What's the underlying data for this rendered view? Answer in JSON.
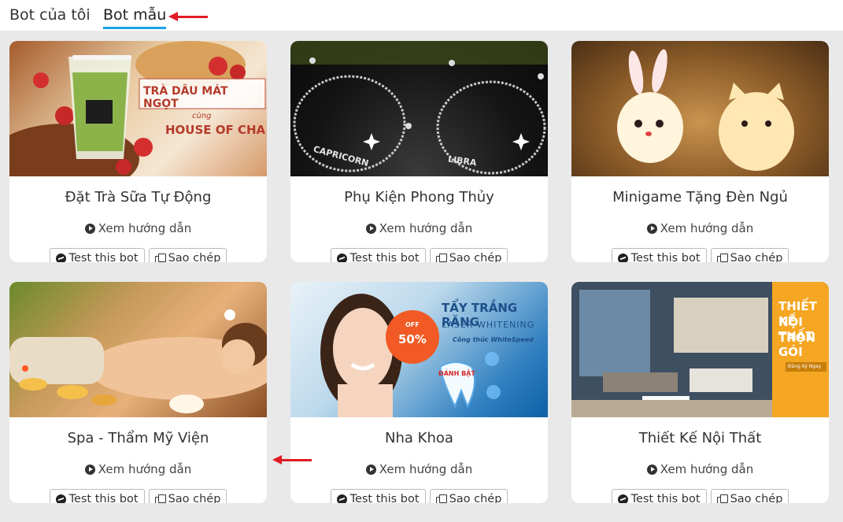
{
  "tabs": [
    {
      "label": "Bot của tôi"
    },
    {
      "label": "Bot mẫu"
    }
  ],
  "cards": [
    {
      "title": "Đặt Trà Sữa Tự Động",
      "image_texts": [
        "TRÀ DÂU MÁT NGỌT",
        "cùng",
        "HOUSE OF CHA"
      ]
    },
    {
      "title": "Phụ Kiện Phong Thủy",
      "image_texts": [
        "CAPRICORN",
        "LIBRA"
      ]
    },
    {
      "title": "Minigame Tặng Đèn Ngủ",
      "image_texts": []
    },
    {
      "title": "Spa - Thẩm Mỹ Viện",
      "image_texts": []
    },
    {
      "title": "Nha Khoa",
      "image_texts": [
        "TẨY TRẮNG RĂNG",
        "LASER WHITENING",
        "Công thức WhiteSpeed",
        "OFF",
        "50%",
        "ĐÁNH BẬT"
      ]
    },
    {
      "title": "Thiết Kế Nội Thất",
      "image_texts": [
        "THIẾT KẾ",
        "NỘI THẤT",
        "TRỌN GÓI",
        "Đăng Ký Ngay"
      ]
    }
  ],
  "card_common": {
    "guide_label": "Xem hướng dẫn",
    "test_label": "Test this bot",
    "copy_label": "Sao chép"
  },
  "icons": [
    "play-circle-icon",
    "messenger-icon",
    "copy-icon",
    "arrow-left-icon"
  ],
  "colors": {
    "accent": "#1aa3e8",
    "annotation_arrow": "#e01b24",
    "background": "#e9e9e9"
  }
}
